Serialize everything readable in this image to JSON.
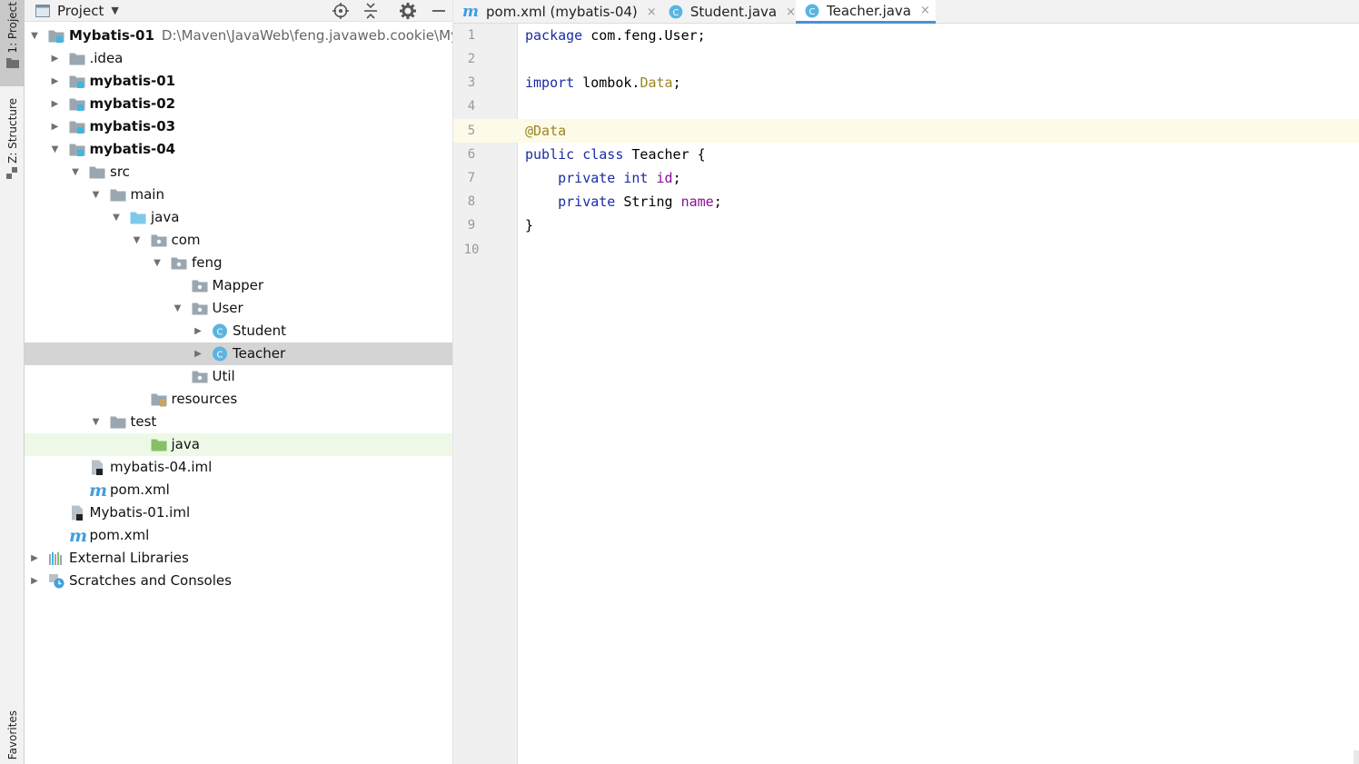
{
  "left_strip": {
    "project_tab": "1: Project",
    "structure_tab": "Z: Structure",
    "favorites_tab": "Favorites"
  },
  "project_panel": {
    "title": "Project",
    "tree": [
      {
        "label": "Mybatis-01",
        "path": "D:\\Maven\\JavaWeb\\feng.javaweb.cookie\\Myb",
        "bold": true,
        "arrow": "down",
        "icon": "module-folder-icon"
      },
      {
        "label": ".idea",
        "arrow": "right",
        "icon": "folder-icon"
      },
      {
        "label": "mybatis-01",
        "bold": true,
        "arrow": "right",
        "icon": "module-folder-icon"
      },
      {
        "label": "mybatis-02",
        "bold": true,
        "arrow": "right",
        "icon": "module-folder-icon"
      },
      {
        "label": "mybatis-03",
        "bold": true,
        "arrow": "right",
        "icon": "module-folder-icon"
      },
      {
        "label": "mybatis-04",
        "bold": true,
        "arrow": "down",
        "icon": "module-folder-icon"
      },
      {
        "label": "src",
        "arrow": "down",
        "icon": "folder-icon"
      },
      {
        "label": "main",
        "arrow": "down",
        "icon": "folder-icon"
      },
      {
        "label": "java",
        "arrow": "down",
        "icon": "source-folder-icon"
      },
      {
        "label": "com",
        "arrow": "down",
        "icon": "package-icon"
      },
      {
        "label": "feng",
        "arrow": "down",
        "icon": "package-icon"
      },
      {
        "label": "Mapper",
        "arrow": "",
        "icon": "package-icon"
      },
      {
        "label": "User",
        "arrow": "down",
        "icon": "package-icon"
      },
      {
        "label": "Student",
        "arrow": "right",
        "icon": "class-icon"
      },
      {
        "label": "Teacher",
        "arrow": "right",
        "icon": "class-icon",
        "selected": true
      },
      {
        "label": "Util",
        "arrow": "",
        "icon": "package-icon"
      },
      {
        "label": "resources",
        "arrow": "",
        "icon": "resources-folder-icon"
      },
      {
        "label": "test",
        "arrow": "down",
        "icon": "folder-icon"
      },
      {
        "label": "java",
        "arrow": "",
        "icon": "test-folder-icon",
        "focused": true
      },
      {
        "label": "mybatis-04.iml",
        "arrow": "",
        "icon": "iml-file-icon"
      },
      {
        "label": "pom.xml",
        "arrow": "",
        "icon": "maven-icon"
      },
      {
        "label": "Mybatis-01.iml",
        "arrow": "",
        "icon": "iml-file-icon"
      },
      {
        "label": "pom.xml",
        "arrow": "",
        "icon": "maven-icon"
      },
      {
        "label": "External Libraries",
        "arrow": "right",
        "icon": "libraries-icon"
      },
      {
        "label": "Scratches and Consoles",
        "arrow": "right",
        "icon": "scratches-icon"
      }
    ]
  },
  "editor": {
    "tabs": [
      {
        "label": "pom.xml (mybatis-04)",
        "icon": "maven-icon",
        "close": "×"
      },
      {
        "label": "Student.java",
        "icon": "class-icon",
        "close": "×"
      },
      {
        "label": "Teacher.java",
        "icon": "class-icon",
        "close": "×",
        "active": true
      }
    ],
    "line_numbers": [
      "1",
      "2",
      "3",
      "4",
      "5",
      "6",
      "7",
      "8",
      "9",
      "10"
    ],
    "code": {
      "l1_kw": "package",
      "l1_rest": " com.feng.User;",
      "l3_kw": "import",
      "l3_a": " lombok.",
      "l3_type": "Data",
      "l3_b": ";",
      "l5_ann": "@Data",
      "l6_kw1": "public",
      "l6_kw2": "class",
      "l6_rest": " Teacher {",
      "l7_kw1": "private",
      "l7_kw2": "int",
      "l7_fld": "id",
      "l7_end": ";",
      "l8_kw1": "private",
      "l8_type": " String ",
      "l8_fld": "name",
      "l8_end": ";",
      "l9": "}"
    }
  },
  "colors": {
    "keyword": "#1a2ca3",
    "annotation": "#9c8622",
    "field": "#871094",
    "selection": "#d4d4d4",
    "active_tab_underline": "#4a8fd8"
  }
}
